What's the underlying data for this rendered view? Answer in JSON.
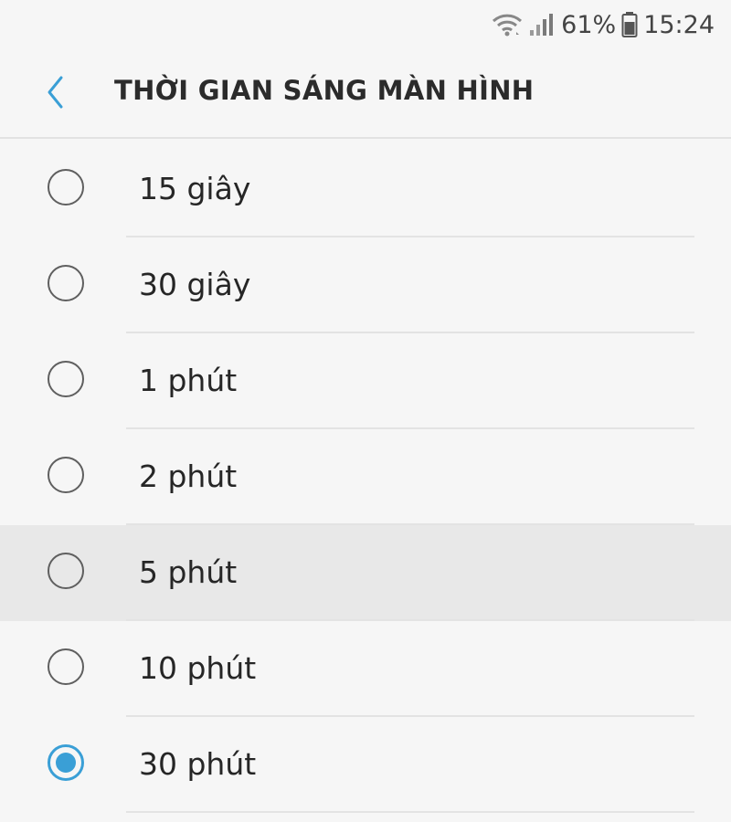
{
  "status_bar": {
    "battery": "61%",
    "time": "15:24",
    "icons": [
      "wifi-icon",
      "signal-icon",
      "battery-icon"
    ]
  },
  "header": {
    "back_icon": "chevron-left-icon",
    "title": "THỜI GIAN SÁNG MÀN HÌNH"
  },
  "options": [
    {
      "label": "15 giây",
      "selected": false
    },
    {
      "label": "30 giây",
      "selected": false
    },
    {
      "label": "1 phút",
      "selected": false
    },
    {
      "label": "2 phút",
      "selected": false
    },
    {
      "label": "5 phút",
      "selected": false,
      "pressed": true
    },
    {
      "label": "10 phút",
      "selected": false
    },
    {
      "label": "30 phút",
      "selected": true
    }
  ],
  "colors": {
    "accent": "#3a9fd6",
    "background": "#f6f6f6",
    "pressed_row": "#e8e8e8"
  }
}
